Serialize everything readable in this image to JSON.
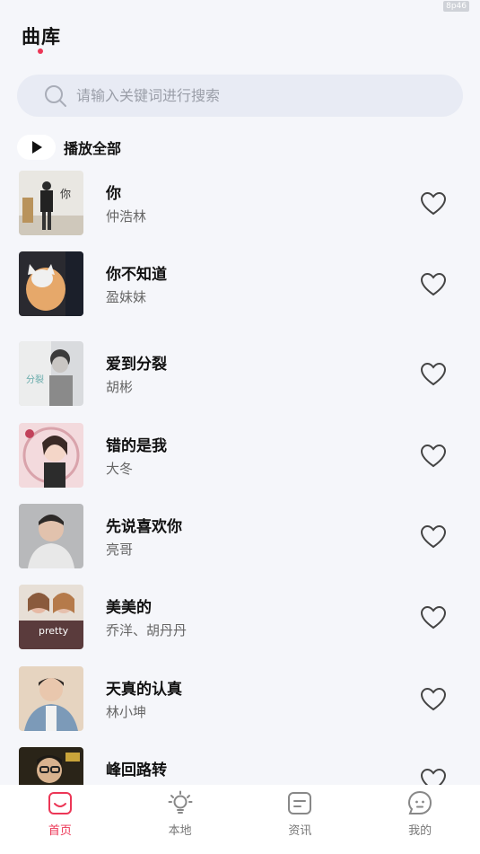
{
  "status": {
    "badge": "8p46"
  },
  "header": {
    "title": "曲库"
  },
  "search": {
    "placeholder": "请输入关键词进行搜索"
  },
  "play_all": {
    "label": "播放全部"
  },
  "songs": [
    {
      "title": "你",
      "artist": "仲浩林"
    },
    {
      "title": "你不知道",
      "artist": "盈妹妹"
    },
    {
      "title": "爱到分裂",
      "artist": "胡彬"
    },
    {
      "title": "错的是我",
      "artist": "大冬"
    },
    {
      "title": "先说喜欢你",
      "artist": "亮哥"
    },
    {
      "title": "美美的",
      "artist": "乔洋、胡丹丹",
      "cover_text": "pretty"
    },
    {
      "title": "天真的认真",
      "artist": "林小坤"
    },
    {
      "title": "峰回路转",
      "artist": ""
    }
  ],
  "tabs": [
    {
      "label": "首页",
      "icon": "home-icon",
      "active": true
    },
    {
      "label": "本地",
      "icon": "lightbulb-icon",
      "active": false
    },
    {
      "label": "资讯",
      "icon": "news-icon",
      "active": false
    },
    {
      "label": "我的",
      "icon": "profile-icon",
      "active": false
    }
  ],
  "colors": {
    "accent": "#ec3656",
    "background": "#f5f6fa",
    "search_bg": "#e8ebf4"
  }
}
